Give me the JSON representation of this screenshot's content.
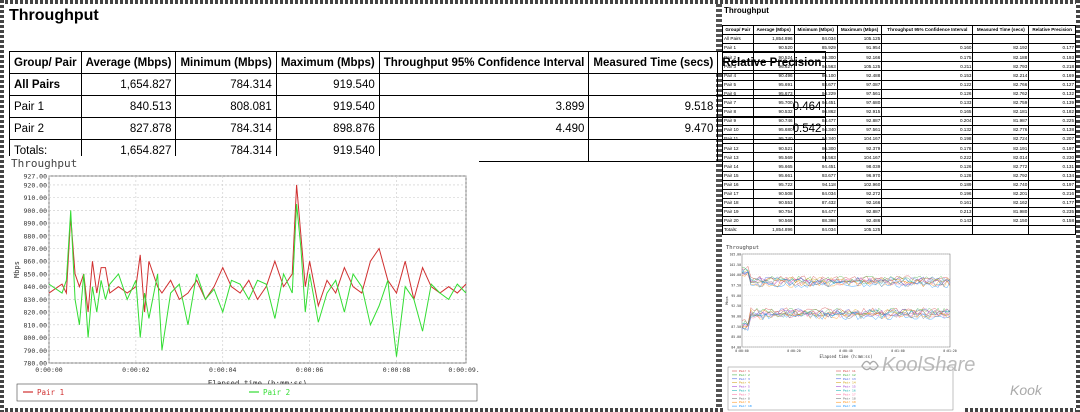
{
  "left": {
    "title": "Throughput",
    "table": {
      "headers": [
        "Group/ Pair",
        "Average (Mbps)",
        "Minimum (Mbps)",
        "Maximum (Mbps)",
        "Throughput 95% Confidence Interval",
        "Measured Time (secs)",
        "Relative Precision"
      ],
      "rows": [
        {
          "label": "All Pairs",
          "bold": true,
          "cells": [
            "1,654.827",
            "784.314",
            "919.540",
            "",
            "",
            ""
          ]
        },
        {
          "label": "Pair 1",
          "bold": false,
          "cells": [
            "840.513",
            "808.081",
            "919.540",
            "3.899",
            "9.518",
            "0.464"
          ]
        },
        {
          "label": "Pair 2",
          "bold": false,
          "cells": [
            "827.878",
            "784.314",
            "898.876",
            "4.490",
            "9.470",
            "0.542"
          ]
        },
        {
          "label": "Totals:",
          "bold": false,
          "cells": [
            "1,654.827",
            "784.314",
            "919.540",
            "",
            "",
            ""
          ]
        }
      ]
    }
  },
  "right": {
    "title": "Throughput",
    "table": {
      "headers": [
        "Group/ Pair",
        "Average (Mbps)",
        "Minimum (Mbps)",
        "Maximum (Mbps)",
        "Throughput 95% Confidence Interval",
        "Measured Time (secs)",
        "Relative Precision"
      ],
      "rows": [
        [
          "All Pairs",
          "1,854.896",
          "84.034",
          "105.125",
          "",
          "",
          ""
        ],
        [
          "Pair 1",
          "90.520",
          "85.929",
          "91.954",
          "0.160",
          "82.192",
          "0.177"
        ],
        [
          "Pair 2",
          "90.524",
          "86.300",
          "92.166",
          "0.175",
          "82.188",
          "0.193"
        ],
        [
          "Pair 3",
          "96.627",
          "94.563",
          "105.125",
          "0.211",
          "82.793",
          "0.218"
        ],
        [
          "Pair 4",
          "90.496",
          "86.100",
          "92.488",
          "0.153",
          "82.214",
          "0.169"
        ],
        [
          "Pair 5",
          "95.691",
          "93.677",
          "97.087",
          "0.122",
          "82.766",
          "0.127"
        ],
        [
          "Pair 6",
          "95.673",
          "94.229",
          "97.561",
          "0.126",
          "82.762",
          "0.132"
        ],
        [
          "Pair 7",
          "95.700",
          "94.451",
          "97.680",
          "0.133",
          "82.759",
          "0.139"
        ],
        [
          "Pair 8",
          "90.532",
          "86.862",
          "92.915",
          "0.165",
          "82.181",
          "0.182"
        ],
        [
          "Pair 9",
          "90.746",
          "84.477",
          "92.887",
          "0.204",
          "81.987",
          "0.225"
        ],
        [
          "Pair 10",
          "95.680",
          "94.340",
          "97.561",
          "0.132",
          "82.776",
          "0.138"
        ],
        [
          "Pair 11",
          "95.740",
          "94.340",
          "104.167",
          "0.198",
          "82.724",
          "0.207"
        ],
        [
          "Pair 12",
          "90.521",
          "86.300",
          "92.379",
          "0.178",
          "82.191",
          "0.197"
        ],
        [
          "Pair 13",
          "95.569",
          "94.563",
          "104.167",
          "0.222",
          "82.014",
          "0.230"
        ],
        [
          "Pair 14",
          "95.665",
          "94.451",
          "98.039",
          "0.126",
          "82.772",
          "0.131"
        ],
        [
          "Pair 15",
          "95.661",
          "93.677",
          "96.970",
          "0.128",
          "82.792",
          "0.134"
        ],
        [
          "Pair 16",
          "95.722",
          "94.118",
          "102.960",
          "0.189",
          "82.740",
          "0.197"
        ],
        [
          "Pair 17",
          "90.508",
          "84.034",
          "92.272",
          "0.196",
          "82.201",
          "0.216"
        ],
        [
          "Pair 18",
          "90.553",
          "87.432",
          "92.166",
          "0.161",
          "82.162",
          "0.177"
        ],
        [
          "Pair 19",
          "90.754",
          "84.477",
          "92.887",
          "0.213",
          "81.980",
          "0.235"
        ],
        [
          "Pair 20",
          "90.566",
          "88.398",
          "92.486",
          "0.143",
          "82.150",
          "0.158"
        ],
        [
          "Totals:",
          "1,854.896",
          "84.034",
          "105.125",
          "",
          "",
          ""
        ]
      ]
    },
    "mini_chart": {
      "title": "Throughput",
      "xlabel": "Elapsed time (h:mm:ss)",
      "ylabel": "Mbps",
      "yticks": [
        "105.00",
        "102.50",
        "100.00",
        "97.50",
        "95.00",
        "92.50",
        "90.00",
        "87.50",
        "85.00",
        "84.00"
      ],
      "xticks": [
        "0:00:00",
        "0:00:20",
        "0:00:40",
        "0:01:00",
        "0:01:20"
      ],
      "legend_left": [
        "Pair 1",
        "Pair 2",
        "Pair 3",
        "Pair 4",
        "Pair 5",
        "Pair 6",
        "Pair 7",
        "Pair 8",
        "Pair 9",
        "Pair 10"
      ],
      "legend_right": [
        "Pair 11",
        "Pair 12",
        "Pair 13",
        "Pair 14",
        "Pair 15",
        "Pair 16",
        "Pair 17",
        "Pair 18",
        "Pair 19",
        "Pair 20"
      ]
    }
  },
  "watermark": {
    "text": "KoolShare",
    "sub": "Kook"
  },
  "colors": {
    "pair1": "#d03030",
    "pair2": "#33dd33",
    "grid": "#c8c8c8"
  },
  "chart_data": {
    "type": "line",
    "title": "Throughput",
    "xlabel": "Elapsed time (h:mm:ss)",
    "ylabel": "Mbps",
    "ylim": [
      780,
      927
    ],
    "xlim": [
      0,
      9.6
    ],
    "yticks": [
      "927.00",
      "920.00",
      "910.00",
      "900.00",
      "890.00",
      "880.00",
      "870.00",
      "860.00",
      "850.00",
      "840.00",
      "830.00",
      "820.00",
      "810.00",
      "800.00",
      "790.00",
      "780.00"
    ],
    "xticks": [
      {
        "v": 0,
        "label": "0:00:00"
      },
      {
        "v": 2,
        "label": "0:00:02"
      },
      {
        "v": 4,
        "label": "0:00:04"
      },
      {
        "v": 6,
        "label": "0:00:06"
      },
      {
        "v": 8,
        "label": "0:00:08"
      },
      {
        "v": 9.6,
        "label": "0:00:09.6"
      }
    ],
    "legend": "bottom",
    "series": [
      {
        "name": "Pair 1",
        "color": "#d03030",
        "x": [
          0,
          0.3,
          0.4,
          0.5,
          0.6,
          0.7,
          0.8,
          0.9,
          1.0,
          1.1,
          1.2,
          1.3,
          1.4,
          1.6,
          1.8,
          2.0,
          2.1,
          2.2,
          2.3,
          2.5,
          2.6,
          2.8,
          3.0,
          3.2,
          3.4,
          3.6,
          3.8,
          4.0,
          4.2,
          4.4,
          4.6,
          4.8,
          5.0,
          5.2,
          5.4,
          5.6,
          5.7,
          5.8,
          5.9,
          6.0,
          6.2,
          6.4,
          6.6,
          6.8,
          7.0,
          7.2,
          7.4,
          7.6,
          7.8,
          8.0,
          8.2,
          8.4,
          8.6,
          8.8,
          9.0,
          9.2,
          9.4,
          9.6
        ],
        "values": [
          835,
          842,
          835,
          895,
          850,
          840,
          850,
          820,
          860,
          835,
          855,
          855,
          835,
          840,
          835,
          840,
          865,
          820,
          860,
          840,
          835,
          845,
          830,
          835,
          845,
          830,
          840,
          855,
          840,
          835,
          845,
          830,
          840,
          860,
          840,
          850,
          920,
          880,
          840,
          860,
          825,
          845,
          835,
          855,
          840,
          835,
          860,
          870,
          845,
          835,
          860,
          830,
          855,
          840,
          835,
          840,
          835,
          842
        ]
      },
      {
        "name": "Pair 2",
        "color": "#33dd33",
        "x": [
          0,
          0.3,
          0.4,
          0.5,
          0.6,
          0.7,
          0.8,
          0.9,
          1.0,
          1.1,
          1.2,
          1.3,
          1.4,
          1.6,
          1.8,
          2.0,
          2.1,
          2.2,
          2.3,
          2.5,
          2.6,
          2.8,
          3.0,
          3.2,
          3.4,
          3.6,
          3.8,
          4.0,
          4.2,
          4.4,
          4.6,
          4.8,
          5.0,
          5.2,
          5.4,
          5.6,
          5.7,
          5.8,
          5.9,
          6.0,
          6.2,
          6.4,
          6.6,
          6.8,
          7.0,
          7.2,
          7.4,
          7.6,
          7.8,
          8.0,
          8.2,
          8.4,
          8.6,
          8.8,
          9.0,
          9.2,
          9.4,
          9.6
        ],
        "values": [
          842,
          835,
          845,
          900,
          830,
          810,
          850,
          800,
          840,
          820,
          845,
          830,
          842,
          850,
          830,
          845,
          800,
          835,
          815,
          850,
          790,
          835,
          842,
          810,
          850,
          830,
          838,
          820,
          845,
          842,
          830,
          845,
          842,
          815,
          850,
          835,
          905,
          870,
          820,
          850,
          812,
          835,
          845,
          820,
          850,
          840,
          810,
          825,
          845,
          785,
          840,
          830,
          805,
          842,
          835,
          830,
          842,
          835
        ]
      }
    ]
  }
}
